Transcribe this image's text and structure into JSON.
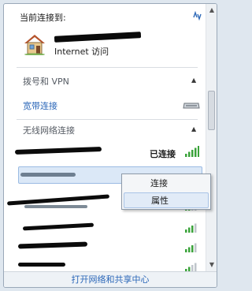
{
  "header": {
    "current_connection_label": "当前连接到:",
    "internet_access": "Internet 访问"
  },
  "sections": {
    "dialup": {
      "title": "拨号和 VPN",
      "broadband_link": "宽带连接"
    },
    "wireless": {
      "title": "无线网络连接",
      "connected_status": "已连接"
    }
  },
  "context_menu": {
    "items": [
      "连接",
      "属性"
    ]
  },
  "footer": {
    "open_center": "打开网络和共享中心"
  },
  "icons": [
    "refresh-icon",
    "house-icon",
    "modem-icon",
    "wifi-signal-icon",
    "chevron-up-icon"
  ]
}
